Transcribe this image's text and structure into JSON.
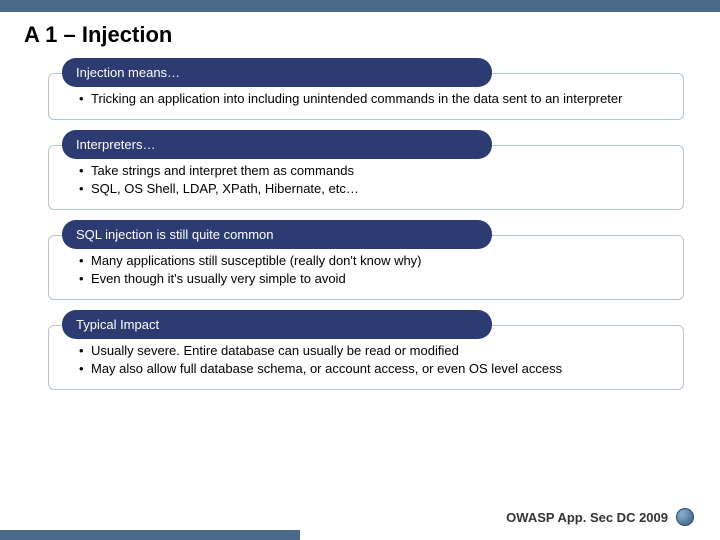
{
  "title": "A 1 – Injection",
  "sections": [
    {
      "header": "Injection means…",
      "bullets": [
        "Tricking an application into including unintended commands in the data sent to an interpreter"
      ]
    },
    {
      "header": "Interpreters…",
      "bullets": [
        "Take strings and interpret them as commands",
        "SQL, OS Shell, LDAP, XPath, Hibernate, etc…"
      ]
    },
    {
      "header": "SQL injection is still quite common",
      "bullets": [
        "Many applications still susceptible (really don't know why)",
        "Even though it's usually very simple to avoid"
      ]
    },
    {
      "header": "Typical Impact",
      "bullets": [
        "Usually severe. Entire database can usually be read or modified",
        "May also allow full database schema, or account access, or even OS level access"
      ]
    }
  ],
  "footer": "OWASP App. Sec DC 2009"
}
